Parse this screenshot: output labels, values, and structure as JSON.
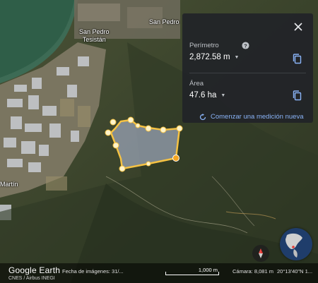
{
  "places": {
    "san_pedro_tesistan_line1": "San Pedro",
    "san_pedro_tesistan_line2": "Tesistán",
    "san_pedro": "San Pedro",
    "martin": "Martín"
  },
  "measure_panel": {
    "perimeter_label": "Perímetro",
    "perimeter_value": "2,872.58 m",
    "area_label": "Área",
    "area_value": "47.6 ha",
    "new_measurement": "Comenzar una medición nueva",
    "accent_color": "#8ab4f8"
  },
  "bottom_bar": {
    "logo": "Google Earth",
    "credits": "CNES / Airbus  INEGI",
    "imagery_date": "Fecha de imágenes: 31/...",
    "scale": "1,000 m",
    "camera": "Cámara: 8,081 m",
    "coordinates": "20°13'40\"N 1..."
  },
  "polygon": {
    "stroke_color": "#f5c243",
    "fill_color": "#9aa3b5"
  }
}
